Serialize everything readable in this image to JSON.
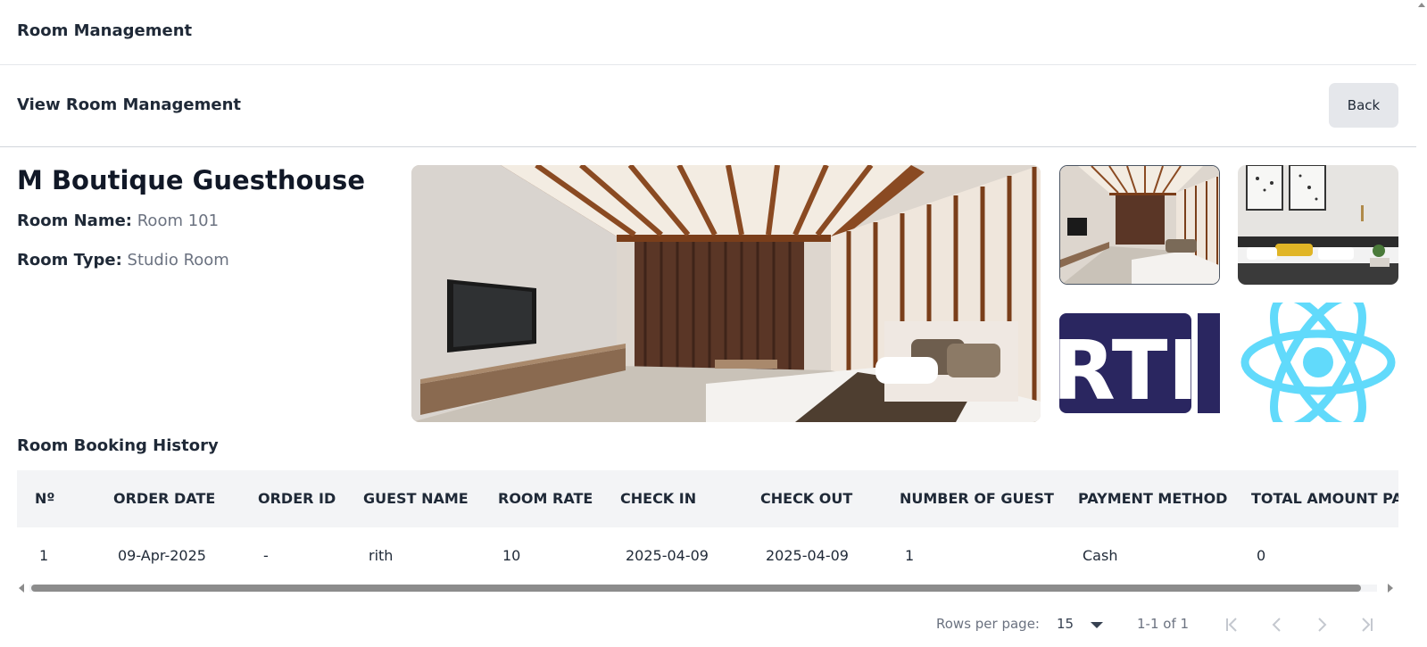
{
  "header": {
    "title": "Room Management"
  },
  "subheader": {
    "title": "View Room Management",
    "back_label": "Back"
  },
  "room": {
    "hotel_name": "M Boutique Guesthouse",
    "name_label": "Room Name:",
    "name_value": "Room 101",
    "type_label": "Room Type:",
    "type_value": "Studio Room"
  },
  "gallery": {
    "main_image": "hotel-room-photo",
    "thumbnails": [
      "hotel-room-photo",
      "bedroom-art-photo",
      "arti-logo",
      "react-logo"
    ],
    "arti_text": "RTI"
  },
  "history": {
    "title": "Room Booking History",
    "columns": [
      "Nº",
      "ORDER DATE",
      "ORDER ID",
      "GUEST NAME",
      "ROOM RATE",
      "CHECK IN",
      "CHECK OUT",
      "NUMBER OF GUEST",
      "PAYMENT METHOD",
      "TOTAL AMOUNT PAID"
    ],
    "rows": [
      [
        "1",
        "09-Apr-2025",
        "-",
        "rith",
        "10",
        "2025-04-09",
        "2025-04-09",
        "1",
        "Cash",
        "0"
      ]
    ]
  },
  "pagination": {
    "rows_per_page_label": "Rows per page:",
    "rows_per_page_value": "15",
    "range": "1-1 of 1"
  },
  "colors": {
    "header_row_bg": "#f3f4f6",
    "button_bg": "#e5e7eb",
    "react_blue": "#61dafb",
    "arti_navy": "#2a2660"
  }
}
